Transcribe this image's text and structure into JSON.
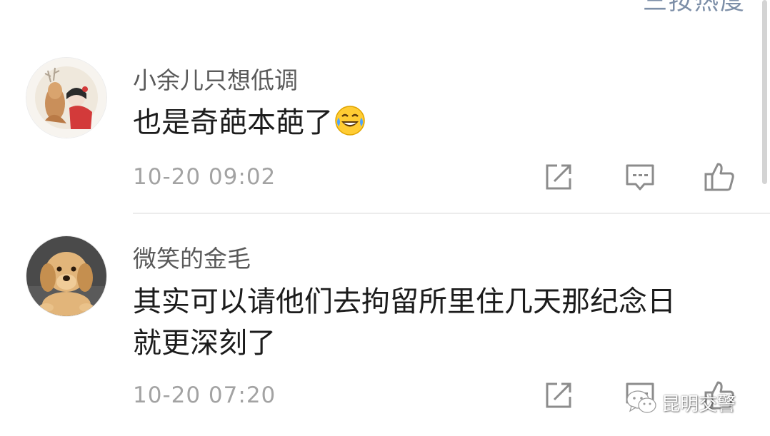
{
  "header": {
    "sort_label": "三按热度"
  },
  "comments": [
    {
      "username": "小余儿只想低调",
      "text_lines": [
        "也是奇葩本葩了"
      ],
      "emoji": "laughing-crying-emoji",
      "time": "10-20 09:02",
      "avatar": "avatar-deer-illustration"
    },
    {
      "username": "微笑的金毛",
      "text_lines": [
        "其实可以请他们去拘留所里住几天那纪念日",
        "就更深刻了"
      ],
      "time": "10-20 07:20",
      "avatar": "avatar-golden-retriever"
    }
  ],
  "actions": {
    "share_icon": "share-icon",
    "comment_icon": "comment-icon",
    "like_icon": "like-icon"
  },
  "watermark": {
    "text": "昆明交警",
    "icon": "wechat-icon"
  },
  "colors": {
    "username": "#5a5a5a",
    "text": "#1c1c1c",
    "time": "#a3a3a3",
    "icon": "#8c8c8c",
    "divider": "#ececec"
  }
}
